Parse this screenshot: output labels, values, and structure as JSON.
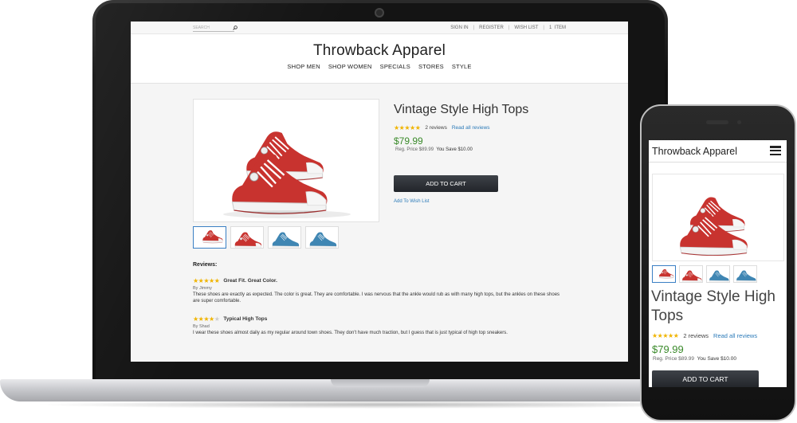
{
  "store": {
    "brand": "Throwback Apparel"
  },
  "topbar": {
    "search_placeholder": "SEARCH",
    "links": [
      "SIGN IN",
      "REGISTER",
      "WISH LIST"
    ],
    "cart_count": "1",
    "cart_label": "ITEM"
  },
  "nav": [
    "SHOP MEN",
    "SHOP WOMEN",
    "SPECIALS",
    "STORES",
    "STYLE"
  ],
  "product": {
    "title": "Vintage Style High Tops",
    "rating_stars": 4.5,
    "reviews_count": "2 reviews",
    "read_reviews": "Read all reviews",
    "price": "$79.99",
    "reg_price": "Reg. Price $89.99",
    "save": "You Save $10.00",
    "add_to_cart": "ADD TO CART",
    "wish_list": "Add To Wish List"
  },
  "reviews": {
    "heading": "Reviews:",
    "items": [
      {
        "stars": 5,
        "title": "Great Fit. Great Color.",
        "by": "By Jimmy",
        "body": "These shoes are exactly as expected. The color is great. They are comfortable. I was nervous that the ankle would rub as with many high tops, but the ankles on these shoes are super comfortable."
      },
      {
        "stars": 4,
        "title": "Typical High Tops",
        "by": "By Shad",
        "body": "I wear these shoes almost daily as my regular around town shoes. They don't have much traction, but I guess that is just typical of high top sneakers."
      }
    ]
  },
  "mobile": {
    "title": "Vintage Style High Tops",
    "reviews_count": "2 reviews",
    "read_reviews": "Read all reviews",
    "price": "$79.99",
    "reg_price": "Reg. Price $89.99",
    "save": "You Save $10.00",
    "add_to_cart": "ADD TO CART"
  },
  "colors": {
    "accent_link": "#2b7ab8",
    "price_green": "#3a8a2a",
    "star": "#f0b400",
    "button_dark": "#2d3035"
  }
}
